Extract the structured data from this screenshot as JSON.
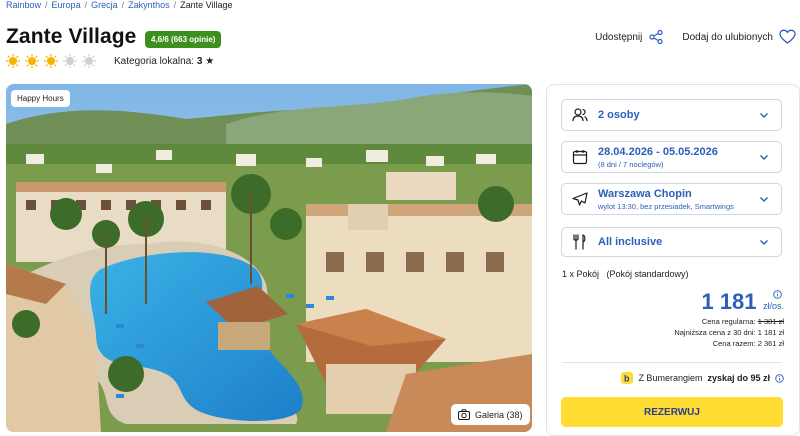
{
  "breadcrumb": {
    "items": [
      "Rainbow",
      "Europa",
      "Grecja",
      "Zakynthos"
    ],
    "current": "Zante Village",
    "separator": "/"
  },
  "hotel": {
    "name": "Zante Village",
    "rating": "4,6/6 (663 opinie)",
    "suns_on": 3,
    "suns_total": 5,
    "category_label": "Kategoria lokalna:",
    "category_value": "3"
  },
  "actions": {
    "share": "Udostępnij",
    "favorite": "Dodaj do ulubionych"
  },
  "photo": {
    "badge": "Happy Hours",
    "gallery": "Galeria (38)"
  },
  "booking": {
    "guests": "2 osoby",
    "dates": "28.04.2026 - 05.05.2026",
    "dates_sub": "(8 dni / 7 noclegów)",
    "flight": "Warszawa Chopin",
    "flight_sub": "wylot 13:30, bez przesiadek, Smartwings",
    "board": "All inclusive",
    "room": "1 x Pokój   (Pokój standardowy)",
    "price": "1 181",
    "price_unit": "zł/os.",
    "regular_label": "Cena regularna:",
    "regular_value": "1 381 zł",
    "lowest_label": "Najniższa cena z 30 dni: 1 181 zł",
    "total_label": "Cena razem: 2 361 zł",
    "bumerang_pre": "Z Bumerangiem",
    "bumerang_bold": "zyskaj do 95 zł",
    "reserve": "REZERWUJ"
  },
  "colors": {
    "link_blue": "#2b5fb8",
    "badge_green": "#3d8f1e",
    "reserve_yellow": "#ffdc32",
    "sun_on": "#f5b400"
  }
}
